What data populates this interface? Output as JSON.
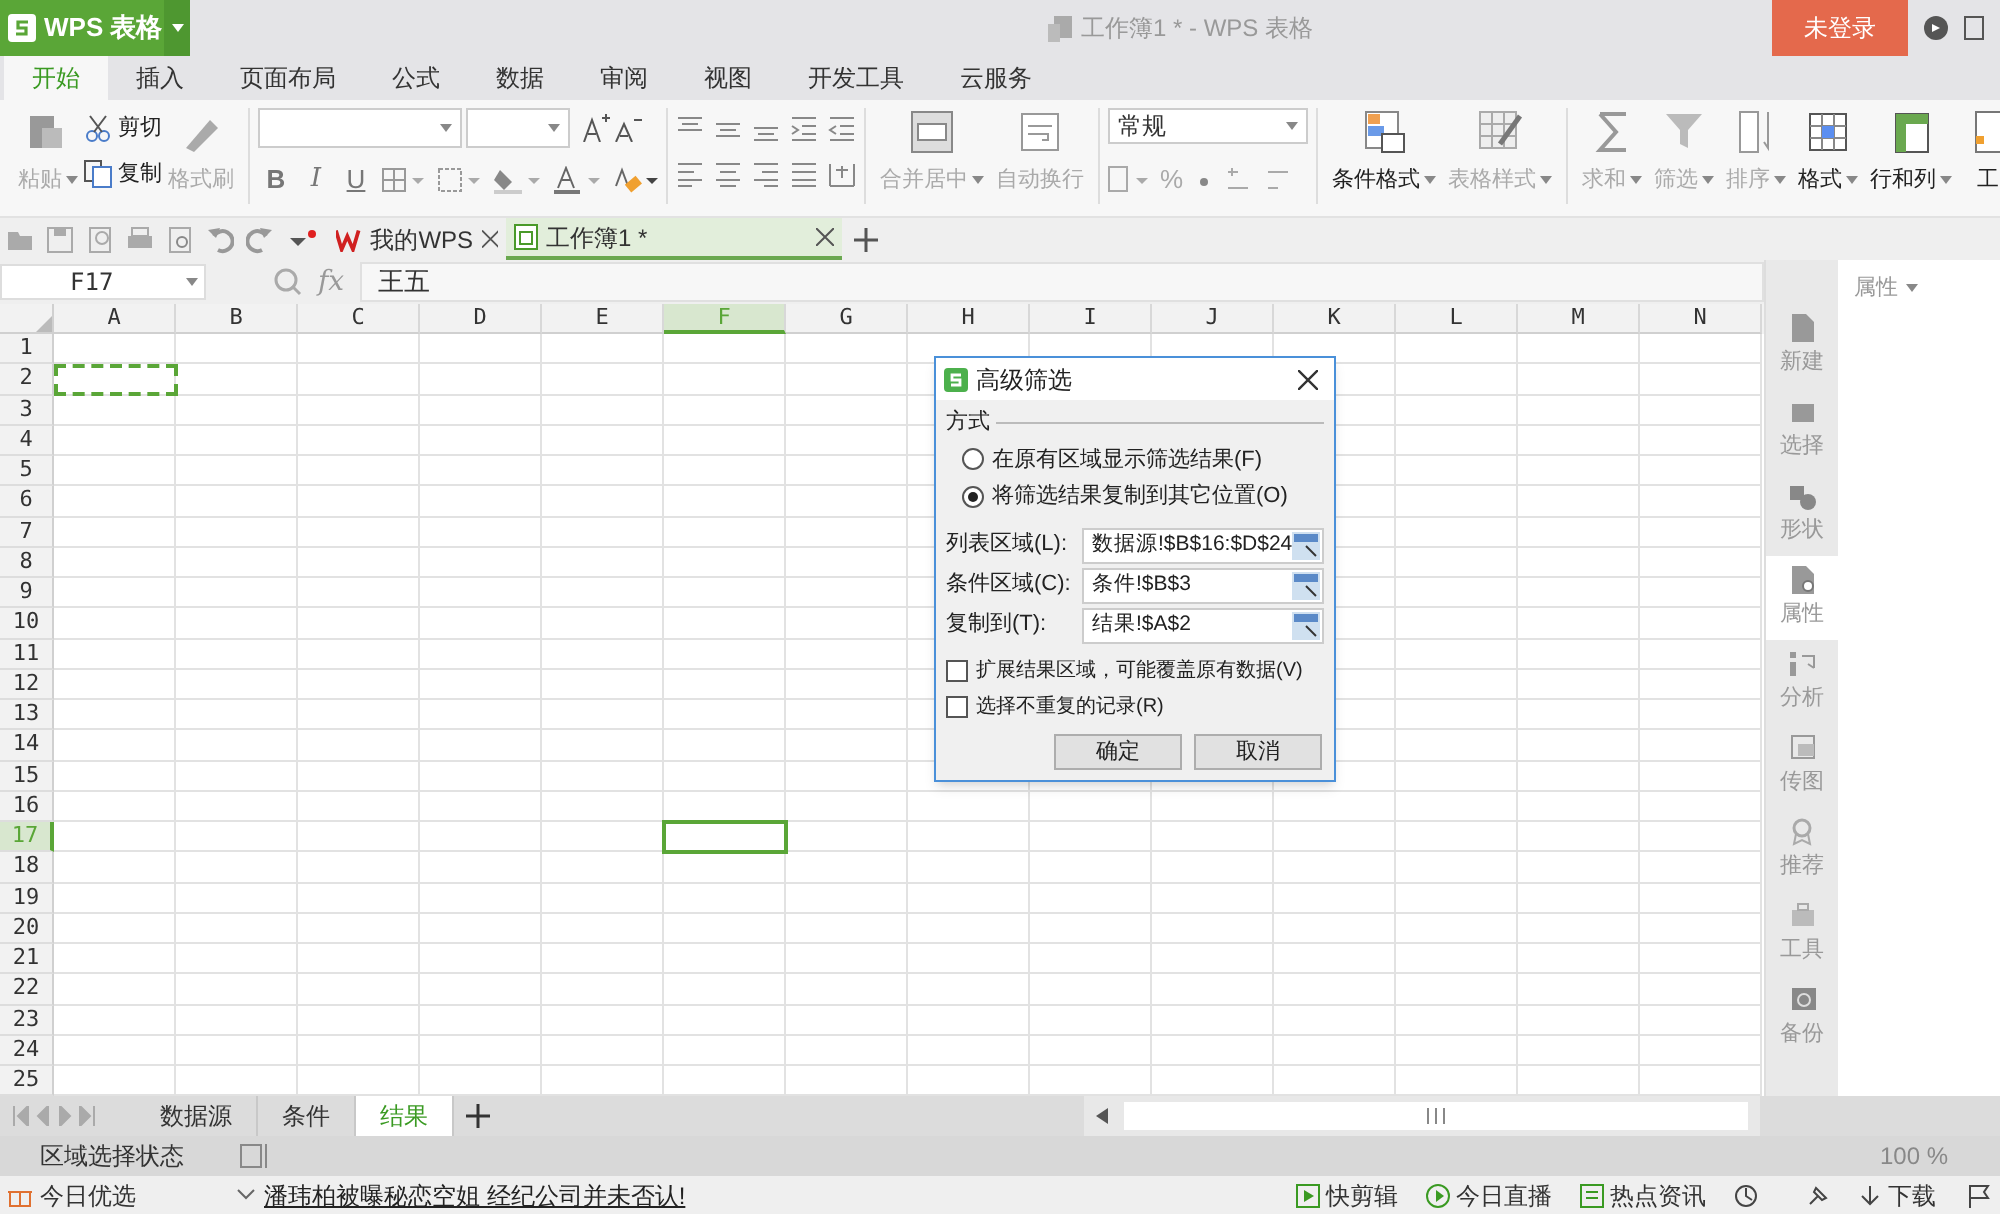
{
  "window": {
    "title": "工作簿1 * - WPS 表格"
  },
  "app_button": {
    "label": "WPS 表格"
  },
  "login_button": {
    "label": "未登录"
  },
  "menu_tabs": [
    {
      "label": "开始",
      "selected": true
    },
    {
      "label": "插入",
      "selected": false
    },
    {
      "label": "页面布局",
      "selected": false
    },
    {
      "label": "公式",
      "selected": false
    },
    {
      "label": "数据",
      "selected": false
    },
    {
      "label": "审阅",
      "selected": false
    },
    {
      "label": "视图",
      "selected": false
    },
    {
      "label": "开发工具",
      "selected": false
    },
    {
      "label": "云服务",
      "selected": false
    }
  ],
  "ribbon": [
    {
      "kind": "clipboard",
      "items": [
        {
          "label": "粘贴",
          "disabled": true,
          "dropdown": true
        },
        {
          "label": "剪切",
          "disabled": false,
          "dropdown": false
        },
        {
          "label": "复制",
          "disabled": false,
          "dropdown": false
        },
        {
          "label": "格式刷",
          "disabled": true,
          "dropdown": false
        }
      ]
    },
    {
      "kind": "font",
      "styles": [
        "B",
        "I",
        "U"
      ]
    },
    {
      "kind": "align"
    },
    {
      "kind": "large",
      "items": [
        {
          "label": "合并居中",
          "disabled": true,
          "dropdown": true
        },
        {
          "label": "自动换行",
          "disabled": true,
          "dropdown": false
        }
      ]
    },
    {
      "kind": "number",
      "format": "常规",
      "percent": "%"
    },
    {
      "kind": "large",
      "items": [
        {
          "label": "条件格式",
          "disabled": false,
          "dropdown": true
        },
        {
          "label": "表格样式",
          "disabled": true,
          "dropdown": true
        }
      ]
    },
    {
      "kind": "large",
      "items": [
        {
          "label": "求和",
          "disabled": true,
          "dropdown": true
        },
        {
          "label": "筛选",
          "disabled": true,
          "dropdown": true
        },
        {
          "label": "排序",
          "disabled": true,
          "dropdown": true
        },
        {
          "label": "格式",
          "disabled": false,
          "dropdown": true
        },
        {
          "label": "行和列",
          "disabled": false,
          "dropdown": true
        },
        {
          "label": "工",
          "disabled": false,
          "dropdown": false
        }
      ]
    }
  ],
  "doc_tabs": [
    {
      "label": "我的WPS",
      "selected": false
    },
    {
      "label": "工作簿1 *",
      "selected": true
    }
  ],
  "formula_bar": {
    "name_box": "F17",
    "fx": "fx",
    "value": "王五"
  },
  "columns": [
    {
      "label": "A",
      "selected": false,
      "marked": true
    },
    {
      "label": "B",
      "selected": false,
      "marked": false
    },
    {
      "label": "C",
      "selected": false,
      "marked": false
    },
    {
      "label": "D",
      "selected": false,
      "marked": false
    },
    {
      "label": "E",
      "selected": false,
      "marked": false
    },
    {
      "label": "F",
      "selected": true,
      "marked": false
    },
    {
      "label": "G",
      "selected": false,
      "marked": false
    },
    {
      "label": "H",
      "selected": false,
      "marked": false
    },
    {
      "label": "I",
      "selected": false,
      "marked": false
    },
    {
      "label": "J",
      "selected": false,
      "marked": false
    },
    {
      "label": "K",
      "selected": false,
      "marked": false
    },
    {
      "label": "L",
      "selected": false,
      "marked": false
    },
    {
      "label": "M",
      "selected": false,
      "marked": false
    },
    {
      "label": "N",
      "selected": false,
      "marked": false
    }
  ],
  "rows": [
    {
      "label": "1",
      "selected": false,
      "marked": false
    },
    {
      "label": "2",
      "selected": false,
      "marked": true
    },
    {
      "label": "3",
      "selected": false,
      "marked": false
    },
    {
      "label": "4",
      "selected": false,
      "marked": false
    },
    {
      "label": "5",
      "selected": false,
      "marked": false
    },
    {
      "label": "6",
      "selected": false,
      "marked": false
    },
    {
      "label": "7",
      "selected": false,
      "marked": false
    },
    {
      "label": "8",
      "selected": false,
      "marked": false
    },
    {
      "label": "9",
      "selected": false,
      "marked": false
    },
    {
      "label": "10",
      "selected": false,
      "marked": false
    },
    {
      "label": "11",
      "selected": false,
      "marked": false
    },
    {
      "label": "12",
      "selected": false,
      "marked": false
    },
    {
      "label": "13",
      "selected": false,
      "marked": false
    },
    {
      "label": "14",
      "selected": false,
      "marked": false
    },
    {
      "label": "15",
      "selected": false,
      "marked": false
    },
    {
      "label": "16",
      "selected": false,
      "marked": false
    },
    {
      "label": "17",
      "selected": true,
      "marked": false
    },
    {
      "label": "18",
      "selected": false,
      "marked": false
    },
    {
      "label": "19",
      "selected": false,
      "marked": false
    },
    {
      "label": "20",
      "selected": false,
      "marked": false
    },
    {
      "label": "21",
      "selected": false,
      "marked": false
    },
    {
      "label": "22",
      "selected": false,
      "marked": false
    },
    {
      "label": "23",
      "selected": false,
      "marked": false
    },
    {
      "label": "24",
      "selected": false,
      "marked": false
    },
    {
      "label": "25",
      "selected": false,
      "marked": false
    }
  ],
  "dialog": {
    "title": "高级筛选",
    "section": "方式",
    "modes": [
      {
        "label": "在原有区域显示筛选结果(F)",
        "selected": false
      },
      {
        "label": "将筛选结果复制到其它位置(O)",
        "selected": true
      }
    ],
    "ranges": [
      {
        "label": "列表区域(L):",
        "value": "数据源!$B$16:$D$24"
      },
      {
        "label": "条件区域(C):",
        "value": "条件!$B$3"
      },
      {
        "label": "复制到(T):",
        "value": "结果!$A$2"
      }
    ],
    "options": [
      {
        "label": "扩展结果区域，可能覆盖原有数据(V)",
        "checked": false
      },
      {
        "label": "选择不重复的记录(R)",
        "checked": false
      }
    ],
    "buttons": [
      "确定",
      "取消"
    ]
  },
  "sidebar": {
    "panel_title": "属性",
    "items": [
      {
        "label": "新建",
        "selected": false
      },
      {
        "label": "选择",
        "selected": false
      },
      {
        "label": "形状",
        "selected": false
      },
      {
        "label": "属性",
        "selected": true
      },
      {
        "label": "分析",
        "selected": false
      },
      {
        "label": "传图",
        "selected": false
      },
      {
        "label": "推荐",
        "selected": false
      },
      {
        "label": "工具",
        "selected": false
      },
      {
        "label": "备份",
        "selected": false
      }
    ]
  },
  "sheet_tabs": [
    {
      "label": "数据源",
      "selected": false
    },
    {
      "label": "条件",
      "selected": false
    },
    {
      "label": "结果",
      "selected": true
    }
  ],
  "status_bar": {
    "mode": "区域选择状态",
    "zoom": "100 %"
  },
  "news_bar": {
    "left": "今日优选",
    "headline": "潘玮柏被曝秘恋空姐 经纪公司并未否认!",
    "items": [
      "快剪辑",
      "今日直播",
      "热点资讯",
      "下载"
    ]
  }
}
